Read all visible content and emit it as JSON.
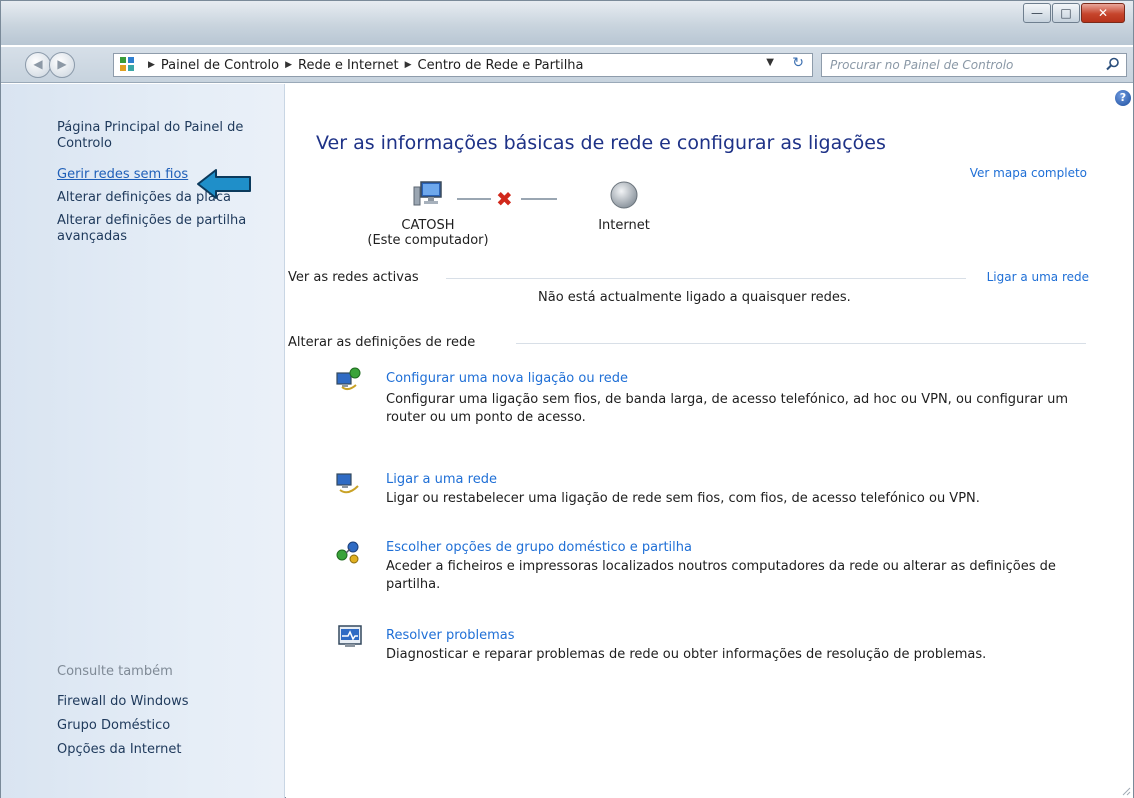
{
  "window": {
    "caption_buttons": {
      "minimize": "—",
      "maximize": "□",
      "close": "✕"
    }
  },
  "address_bar": {
    "breadcrumb": [
      "Painel de Controlo",
      "Rede e Internet",
      "Centro de Rede e Partilha"
    ],
    "search_placeholder": "Procurar no Painel de Controlo"
  },
  "sidebar": {
    "home_link": "Página Principal do Painel de Controlo",
    "links": [
      "Gerir redes sem fios",
      "Alterar definições da placa",
      "Alterar definições de partilha avançadas"
    ],
    "see_also_heading": "Consulte também",
    "see_also": [
      "Firewall do Windows",
      "Grupo Doméstico",
      "Opções da Internet"
    ]
  },
  "main": {
    "title": "Ver as informações básicas de rede e configurar as ligações",
    "full_map_link": "Ver mapa completo",
    "computer_name": "CATOSH",
    "computer_subtitle": "(Este computador)",
    "internet_label": "Internet",
    "active_networks_label": "Ver as redes activas",
    "connect_link": "Ligar a uma rede",
    "not_connected_text": "Não está actualmente ligado a quaisquer redes.",
    "change_settings_label": "Alterar as definições de rede",
    "tasks": [
      {
        "link": "Configurar uma nova ligação ou rede",
        "description": "Configurar uma ligação sem fios, de banda larga, de acesso telefónico, ad hoc ou VPN, ou configurar um router ou um ponto de acesso.",
        "icon": "new-connection-icon"
      },
      {
        "link": "Ligar a uma rede",
        "description": "Ligar ou restabelecer uma ligação de rede sem fios, com fios, de acesso telefónico ou VPN.",
        "icon": "connect-network-icon"
      },
      {
        "link": "Escolher opções de grupo doméstico e partilha",
        "description": "Aceder a ficheiros e impressoras localizados noutros computadores da rede ou alterar as definições de partilha.",
        "icon": "homegroup-icon"
      },
      {
        "link": "Resolver problemas",
        "description": "Diagnosticar e reparar problemas de rede ou obter informações de resolução de problemas.",
        "icon": "troubleshoot-icon"
      }
    ]
  }
}
